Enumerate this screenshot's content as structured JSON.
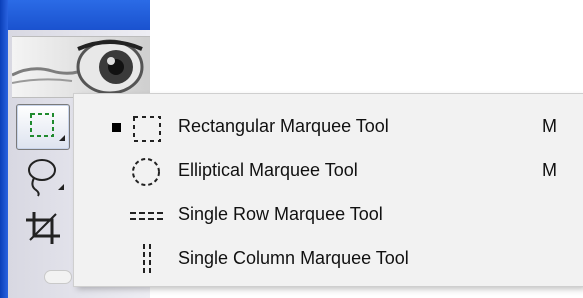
{
  "flyout_menu": {
    "items": [
      {
        "label": "Rectangular Marquee Tool",
        "shortcut": "M",
        "checked": true,
        "icon": "rectangular-marquee-icon"
      },
      {
        "label": "Elliptical Marquee Tool",
        "shortcut": "M",
        "checked": false,
        "icon": "elliptical-marquee-icon"
      },
      {
        "label": "Single Row Marquee Tool",
        "shortcut": "",
        "checked": false,
        "icon": "single-row-marquee-icon"
      },
      {
        "label": "Single Column Marquee Tool",
        "shortcut": "",
        "checked": false,
        "icon": "single-column-marquee-icon"
      }
    ]
  },
  "toolbox": {
    "tools": [
      {
        "icon": "rectangular-marquee-icon",
        "selected": true
      },
      {
        "icon": "lasso-icon",
        "selected": false
      },
      {
        "icon": "crop-icon",
        "selected": false
      }
    ]
  },
  "colors": {
    "title_bar": "#1a52cf",
    "menu_background": "#f2f2f2",
    "selection_marquee": "#1f8a2e"
  }
}
